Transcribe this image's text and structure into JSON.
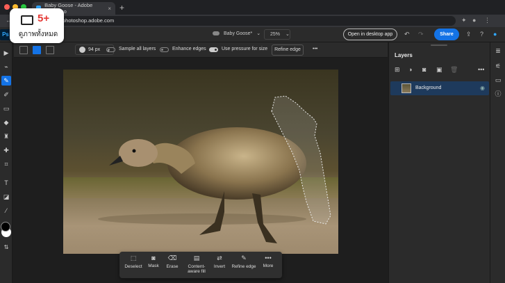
{
  "browser": {
    "tab_title": "Baby Goose - Adobe Photosho",
    "url": "photoshop.adobe.com",
    "new_tab": "+",
    "tab_close": "×",
    "traffic_colors": [
      "#ff5f57",
      "#febc2e",
      "#28c840"
    ]
  },
  "app": {
    "logo": "Ps",
    "doc_name": "Baby Goose*",
    "zoom": "25%",
    "open_desktop_label": "Open in desktop app",
    "share_label": "Share",
    "accent": "#1473e6"
  },
  "options": {
    "brush_size": "94 px",
    "sample_all_layers": "Sample all layers",
    "sample_all_layers_on": false,
    "enhance_edges": "Enhance edges",
    "enhance_edges_on": false,
    "use_pressure": "Use pressure for size",
    "use_pressure_on": true,
    "refine_edge": "Refine edge",
    "more": "•••"
  },
  "tools": [
    {
      "name": "move-tool",
      "glyph": "▶"
    },
    {
      "name": "lasso-tool",
      "glyph": "⌁"
    },
    {
      "name": "quick-selection-tool",
      "glyph": "✎",
      "active": true
    },
    {
      "name": "brush-tool",
      "glyph": "✐"
    },
    {
      "name": "eraser-tool",
      "glyph": "▭"
    },
    {
      "name": "fill-tool",
      "glyph": "◆"
    },
    {
      "name": "clone-stamp-tool",
      "glyph": "♜"
    },
    {
      "name": "healing-tool",
      "glyph": "✚"
    },
    {
      "name": "crop-tool",
      "glyph": "⌗"
    },
    {
      "name": "type-tool",
      "glyph": "T"
    },
    {
      "name": "shape-tool",
      "glyph": "◪"
    },
    {
      "name": "eyedropper-tool",
      "glyph": "⁄"
    }
  ],
  "taskbar": {
    "items": [
      {
        "name": "deselect",
        "label": "Deselect",
        "glyph": "⬚"
      },
      {
        "name": "mask",
        "label": "Mask",
        "glyph": "◙"
      },
      {
        "name": "erase",
        "label": "Erase",
        "glyph": "⌫"
      },
      {
        "name": "content-aware-fill",
        "label": "Content-\naware fill",
        "glyph": "▤"
      },
      {
        "name": "invert",
        "label": "Invert",
        "glyph": "⇄"
      },
      {
        "name": "refine-edge",
        "label": "Refine edge",
        "glyph": "✎"
      },
      {
        "name": "more",
        "label": "More",
        "glyph": "•••"
      }
    ]
  },
  "layers": {
    "title": "Layers",
    "more": "•••",
    "items": [
      {
        "name": "Background",
        "visible": true
      }
    ]
  },
  "badge": {
    "count": "5+",
    "label": "ดูภาพทั้งหมด"
  }
}
